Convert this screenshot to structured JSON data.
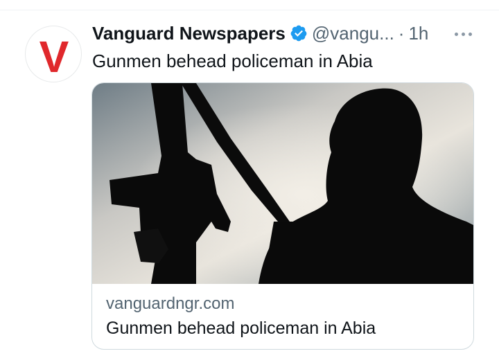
{
  "tweet": {
    "author": {
      "display_name": "Vanguard Newspapers",
      "handle": "@vangu...",
      "separator": "·",
      "time": "1h",
      "avatar_letter": "V",
      "verified": true,
      "avatar_color": "#e0282c"
    },
    "text": "Gunmen behead policeman in Abia",
    "card": {
      "domain": "vanguardngr.com",
      "title": "Gunmen behead policeman in Abia"
    }
  },
  "colors": {
    "verified_blue": "#1d9bf0",
    "secondary_text": "#536471",
    "primary_text": "#0f1419"
  }
}
